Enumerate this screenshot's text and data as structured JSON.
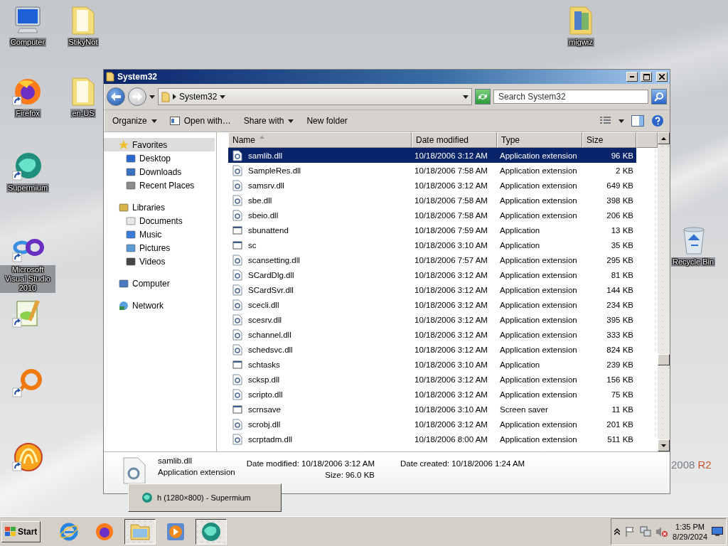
{
  "desktop_icons": [
    {
      "kind": "computer",
      "label": "Computer",
      "shortcut": false
    },
    {
      "kind": "note-folder",
      "label": "StikyNot",
      "shortcut": false
    },
    {
      "kind": "firefox",
      "label": "Firefox",
      "shortcut": true
    },
    {
      "kind": "folder",
      "label": "en-US",
      "shortcut": false
    },
    {
      "kind": "supermium",
      "label": "Supermium",
      "shortcut": true
    },
    {
      "kind": "infinity",
      "label": "Microsoft Visual Studio 2010",
      "shortcut": true
    },
    {
      "kind": "notepad",
      "shortcut": true
    },
    {
      "kind": "ring",
      "shortcut": true
    },
    {
      "kind": "archiver",
      "shortcut": true
    },
    {
      "kind": "photo-folder",
      "label": "migwiz",
      "shortcut": false
    },
    {
      "kind": "recycle",
      "label": "Recycle Bin",
      "shortcut": false
    }
  ],
  "wallpaper_brand": {
    "version": "2008",
    "suffix": "R2"
  },
  "window": {
    "title": "System32",
    "address": {
      "path": "System32"
    },
    "search": {
      "placeholder": "Search System32"
    },
    "toolbar": [
      {
        "label": "Organize",
        "kind": "menu",
        "dropdown": true
      },
      {
        "label": "Open with…",
        "kind": "open",
        "dropdown": false
      },
      {
        "label": "Share with",
        "kind": "menu",
        "dropdown": true
      },
      {
        "label": "New folder",
        "kind": "menu",
        "dropdown": false
      }
    ],
    "nav": [
      {
        "label": "Favorites",
        "kind": "star",
        "selected": true,
        "children": [
          {
            "label": "Desktop",
            "kind": "desktop",
            "selected": false
          },
          {
            "label": "Downloads",
            "kind": "downloads",
            "selected": false
          },
          {
            "label": "Recent Places",
            "kind": "recent",
            "selected": false
          }
        ]
      },
      {
        "label": "Libraries",
        "kind": "libraries",
        "selected": false,
        "children": [
          {
            "label": "Documents",
            "kind": "documents",
            "selected": false
          },
          {
            "label": "Music",
            "kind": "music",
            "selected": false
          },
          {
            "label": "Pictures",
            "kind": "pictures",
            "selected": false
          },
          {
            "label": "Videos",
            "kind": "videos",
            "selected": false
          }
        ]
      },
      {
        "label": "Computer",
        "kind": "computer",
        "selected": false
      },
      {
        "label": "Network",
        "kind": "network",
        "selected": false
      }
    ],
    "columns": [
      {
        "label": "Name",
        "sorted": true
      },
      {
        "label": "Date modified",
        "sorted": false
      },
      {
        "label": "Type",
        "sorted": false
      },
      {
        "label": "Size",
        "sorted": false
      }
    ],
    "rows": [
      {
        "name": "samlib.dll",
        "date": "10/18/2006 3:12 AM",
        "type": "Application extension",
        "size": "96 KB",
        "kind": "dll",
        "selected": true
      },
      {
        "name": "SampleRes.dll",
        "date": "10/18/2006 7:58 AM",
        "type": "Application extension",
        "size": "2 KB",
        "kind": "dll",
        "selected": false
      },
      {
        "name": "samsrv.dll",
        "date": "10/18/2006 3:12 AM",
        "type": "Application extension",
        "size": "649 KB",
        "kind": "dll",
        "selected": false
      },
      {
        "name": "sbe.dll",
        "date": "10/18/2006 7:58 AM",
        "type": "Application extension",
        "size": "398 KB",
        "kind": "dll",
        "selected": false
      },
      {
        "name": "sbeio.dll",
        "date": "10/18/2006 7:58 AM",
        "type": "Application extension",
        "size": "206 KB",
        "kind": "dll",
        "selected": false
      },
      {
        "name": "sbunattend",
        "date": "10/18/2006 7:59 AM",
        "type": "Application",
        "size": "13 KB",
        "kind": "app",
        "selected": false
      },
      {
        "name": "sc",
        "date": "10/18/2006 3:10 AM",
        "type": "Application",
        "size": "35 KB",
        "kind": "app",
        "selected": false
      },
      {
        "name": "scansetting.dll",
        "date": "10/18/2006 7:57 AM",
        "type": "Application extension",
        "size": "295 KB",
        "kind": "dll",
        "selected": false
      },
      {
        "name": "SCardDlg.dll",
        "date": "10/18/2006 3:12 AM",
        "type": "Application extension",
        "size": "81 KB",
        "kind": "dll",
        "selected": false
      },
      {
        "name": "SCardSvr.dll",
        "date": "10/18/2006 3:12 AM",
        "type": "Application extension",
        "size": "144 KB",
        "kind": "dll",
        "selected": false
      },
      {
        "name": "scecli.dll",
        "date": "10/18/2006 3:12 AM",
        "type": "Application extension",
        "size": "234 KB",
        "kind": "dll",
        "selected": false
      },
      {
        "name": "scesrv.dll",
        "date": "10/18/2006 3:12 AM",
        "type": "Application extension",
        "size": "395 KB",
        "kind": "dll",
        "selected": false
      },
      {
        "name": "schannel.dll",
        "date": "10/18/2006 3:12 AM",
        "type": "Application extension",
        "size": "333 KB",
        "kind": "dll",
        "selected": false
      },
      {
        "name": "schedsvc.dll",
        "date": "10/18/2006 3:12 AM",
        "type": "Application extension",
        "size": "824 KB",
        "kind": "dll",
        "selected": false
      },
      {
        "name": "schtasks",
        "date": "10/18/2006 3:10 AM",
        "type": "Application",
        "size": "239 KB",
        "kind": "app",
        "selected": false
      },
      {
        "name": "scksp.dll",
        "date": "10/18/2006 3:12 AM",
        "type": "Application extension",
        "size": "156 KB",
        "kind": "dll",
        "selected": false
      },
      {
        "name": "scripto.dll",
        "date": "10/18/2006 3:12 AM",
        "type": "Application extension",
        "size": "75 KB",
        "kind": "dll",
        "selected": false
      },
      {
        "name": "scrnsave",
        "date": "10/18/2006 3:10 AM",
        "type": "Screen saver",
        "size": "11 KB",
        "kind": "app",
        "selected": false
      },
      {
        "name": "scrobj.dll",
        "date": "10/18/2006 3:12 AM",
        "type": "Application extension",
        "size": "201 KB",
        "kind": "dll",
        "selected": false
      },
      {
        "name": "scrptadm.dll",
        "date": "10/18/2006 8:00 AM",
        "type": "Application extension",
        "size": "511 KB",
        "kind": "dll",
        "selected": false
      }
    ],
    "details": {
      "name": "samlib.dll",
      "type": "Application extension",
      "fields": [
        {
          "label": "Date modified:",
          "value": "10/18/2006 3:12 AM"
        },
        {
          "label": "Size:",
          "value": "96.0 KB"
        },
        {
          "label": "Date created:",
          "value": "10/18/2006 1:24 AM"
        }
      ]
    }
  },
  "thumbnail_popup": {
    "title": "h (1280×800) - Supermium"
  },
  "taskbar": {
    "start": "Start",
    "apps": [
      {
        "kind": "ie",
        "active": false
      },
      {
        "kind": "firefox",
        "active": false
      },
      {
        "kind": "explorer",
        "active": true
      },
      {
        "kind": "media",
        "active": false
      },
      {
        "kind": "supermium",
        "active": true
      }
    ],
    "tray": {
      "time": "1:35 PM",
      "date": "8/29/2024",
      "volume_muted": true
    }
  }
}
